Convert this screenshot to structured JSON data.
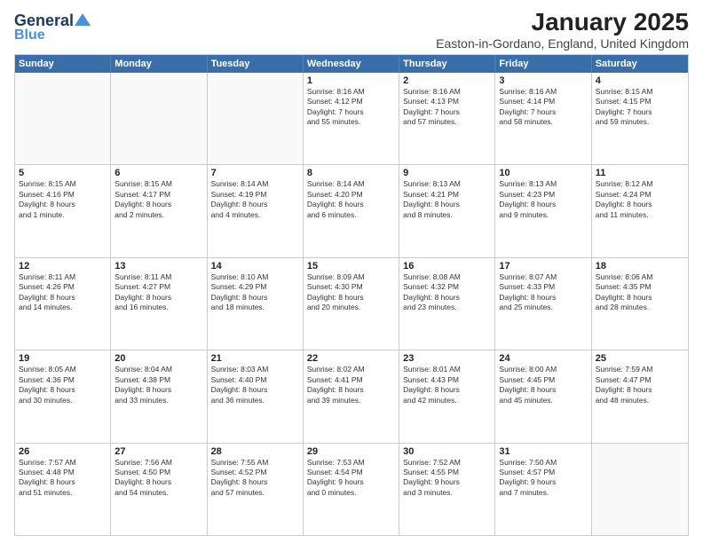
{
  "header": {
    "logo_line1": "General",
    "logo_line2": "Blue",
    "title": "January 2025",
    "subtitle": "Easton-in-Gordano, England, United Kingdom"
  },
  "weekdays": [
    "Sunday",
    "Monday",
    "Tuesday",
    "Wednesday",
    "Thursday",
    "Friday",
    "Saturday"
  ],
  "rows": [
    [
      {
        "day": "",
        "text": ""
      },
      {
        "day": "",
        "text": ""
      },
      {
        "day": "",
        "text": ""
      },
      {
        "day": "1",
        "text": "Sunrise: 8:16 AM\nSunset: 4:12 PM\nDaylight: 7 hours\nand 55 minutes."
      },
      {
        "day": "2",
        "text": "Sunrise: 8:16 AM\nSunset: 4:13 PM\nDaylight: 7 hours\nand 57 minutes."
      },
      {
        "day": "3",
        "text": "Sunrise: 8:16 AM\nSunset: 4:14 PM\nDaylight: 7 hours\nand 58 minutes."
      },
      {
        "day": "4",
        "text": "Sunrise: 8:15 AM\nSunset: 4:15 PM\nDaylight: 7 hours\nand 59 minutes."
      }
    ],
    [
      {
        "day": "5",
        "text": "Sunrise: 8:15 AM\nSunset: 4:16 PM\nDaylight: 8 hours\nand 1 minute."
      },
      {
        "day": "6",
        "text": "Sunrise: 8:15 AM\nSunset: 4:17 PM\nDaylight: 8 hours\nand 2 minutes."
      },
      {
        "day": "7",
        "text": "Sunrise: 8:14 AM\nSunset: 4:19 PM\nDaylight: 8 hours\nand 4 minutes."
      },
      {
        "day": "8",
        "text": "Sunrise: 8:14 AM\nSunset: 4:20 PM\nDaylight: 8 hours\nand 6 minutes."
      },
      {
        "day": "9",
        "text": "Sunrise: 8:13 AM\nSunset: 4:21 PM\nDaylight: 8 hours\nand 8 minutes."
      },
      {
        "day": "10",
        "text": "Sunrise: 8:13 AM\nSunset: 4:23 PM\nDaylight: 8 hours\nand 9 minutes."
      },
      {
        "day": "11",
        "text": "Sunrise: 8:12 AM\nSunset: 4:24 PM\nDaylight: 8 hours\nand 11 minutes."
      }
    ],
    [
      {
        "day": "12",
        "text": "Sunrise: 8:11 AM\nSunset: 4:26 PM\nDaylight: 8 hours\nand 14 minutes."
      },
      {
        "day": "13",
        "text": "Sunrise: 8:11 AM\nSunset: 4:27 PM\nDaylight: 8 hours\nand 16 minutes."
      },
      {
        "day": "14",
        "text": "Sunrise: 8:10 AM\nSunset: 4:29 PM\nDaylight: 8 hours\nand 18 minutes."
      },
      {
        "day": "15",
        "text": "Sunrise: 8:09 AM\nSunset: 4:30 PM\nDaylight: 8 hours\nand 20 minutes."
      },
      {
        "day": "16",
        "text": "Sunrise: 8:08 AM\nSunset: 4:32 PM\nDaylight: 8 hours\nand 23 minutes."
      },
      {
        "day": "17",
        "text": "Sunrise: 8:07 AM\nSunset: 4:33 PM\nDaylight: 8 hours\nand 25 minutes."
      },
      {
        "day": "18",
        "text": "Sunrise: 8:06 AM\nSunset: 4:35 PM\nDaylight: 8 hours\nand 28 minutes."
      }
    ],
    [
      {
        "day": "19",
        "text": "Sunrise: 8:05 AM\nSunset: 4:36 PM\nDaylight: 8 hours\nand 30 minutes."
      },
      {
        "day": "20",
        "text": "Sunrise: 8:04 AM\nSunset: 4:38 PM\nDaylight: 8 hours\nand 33 minutes."
      },
      {
        "day": "21",
        "text": "Sunrise: 8:03 AM\nSunset: 4:40 PM\nDaylight: 8 hours\nand 36 minutes."
      },
      {
        "day": "22",
        "text": "Sunrise: 8:02 AM\nSunset: 4:41 PM\nDaylight: 8 hours\nand 39 minutes."
      },
      {
        "day": "23",
        "text": "Sunrise: 8:01 AM\nSunset: 4:43 PM\nDaylight: 8 hours\nand 42 minutes."
      },
      {
        "day": "24",
        "text": "Sunrise: 8:00 AM\nSunset: 4:45 PM\nDaylight: 8 hours\nand 45 minutes."
      },
      {
        "day": "25",
        "text": "Sunrise: 7:59 AM\nSunset: 4:47 PM\nDaylight: 8 hours\nand 48 minutes."
      }
    ],
    [
      {
        "day": "26",
        "text": "Sunrise: 7:57 AM\nSunset: 4:48 PM\nDaylight: 8 hours\nand 51 minutes."
      },
      {
        "day": "27",
        "text": "Sunrise: 7:56 AM\nSunset: 4:50 PM\nDaylight: 8 hours\nand 54 minutes."
      },
      {
        "day": "28",
        "text": "Sunrise: 7:55 AM\nSunset: 4:52 PM\nDaylight: 8 hours\nand 57 minutes."
      },
      {
        "day": "29",
        "text": "Sunrise: 7:53 AM\nSunset: 4:54 PM\nDaylight: 9 hours\nand 0 minutes."
      },
      {
        "day": "30",
        "text": "Sunrise: 7:52 AM\nSunset: 4:55 PM\nDaylight: 9 hours\nand 3 minutes."
      },
      {
        "day": "31",
        "text": "Sunrise: 7:50 AM\nSunset: 4:57 PM\nDaylight: 9 hours\nand 7 minutes."
      },
      {
        "day": "",
        "text": ""
      }
    ]
  ]
}
